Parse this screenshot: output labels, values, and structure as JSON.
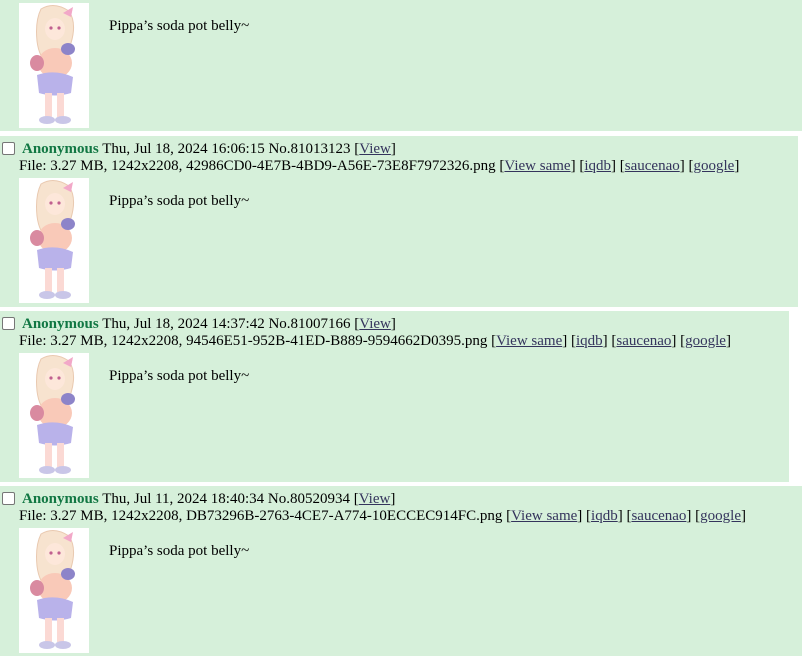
{
  "posts": [
    {
      "comment": "Pippa’s soda pot belly~"
    },
    {
      "name": "Anonymous",
      "datetime": "Thu, Jul 18, 2024 16:06:15",
      "number": "No.81013123",
      "view_label": "View",
      "file_prefix": "File: 3.27 MB, 1242x2208, 42986CD0-4E7B-4BD9-A56E-73E8F7972326.png",
      "links": [
        "View same",
        "iqdb",
        "saucenao",
        "google"
      ],
      "comment": "Pippa’s soda pot belly~"
    },
    {
      "name": "Anonymous",
      "datetime": "Thu, Jul 18, 2024 14:37:42",
      "number": "No.81007166",
      "view_label": "View",
      "file_prefix": "File: 3.27 MB, 1242x2208, 94546E51-952B-41ED-B889-9594662D0395.png",
      "links": [
        "View same",
        "iqdb",
        "saucenao",
        "google"
      ],
      "comment": "Pippa’s soda pot belly~"
    },
    {
      "name": "Anonymous",
      "datetime": "Thu, Jul 11, 2024 18:40:34",
      "number": "No.80520934",
      "view_label": "View",
      "file_prefix": "File: 3.27 MB, 1242x2208, DB73296B-2763-4CE7-A774-10ECCEC914FC.png",
      "links": [
        "View same",
        "iqdb",
        "saucenao",
        "google"
      ],
      "comment": "Pippa’s soda pot belly~"
    }
  ],
  "colors": {
    "post_bg": "#d6f0da",
    "name": "#117743",
    "link": "#34345c"
  }
}
